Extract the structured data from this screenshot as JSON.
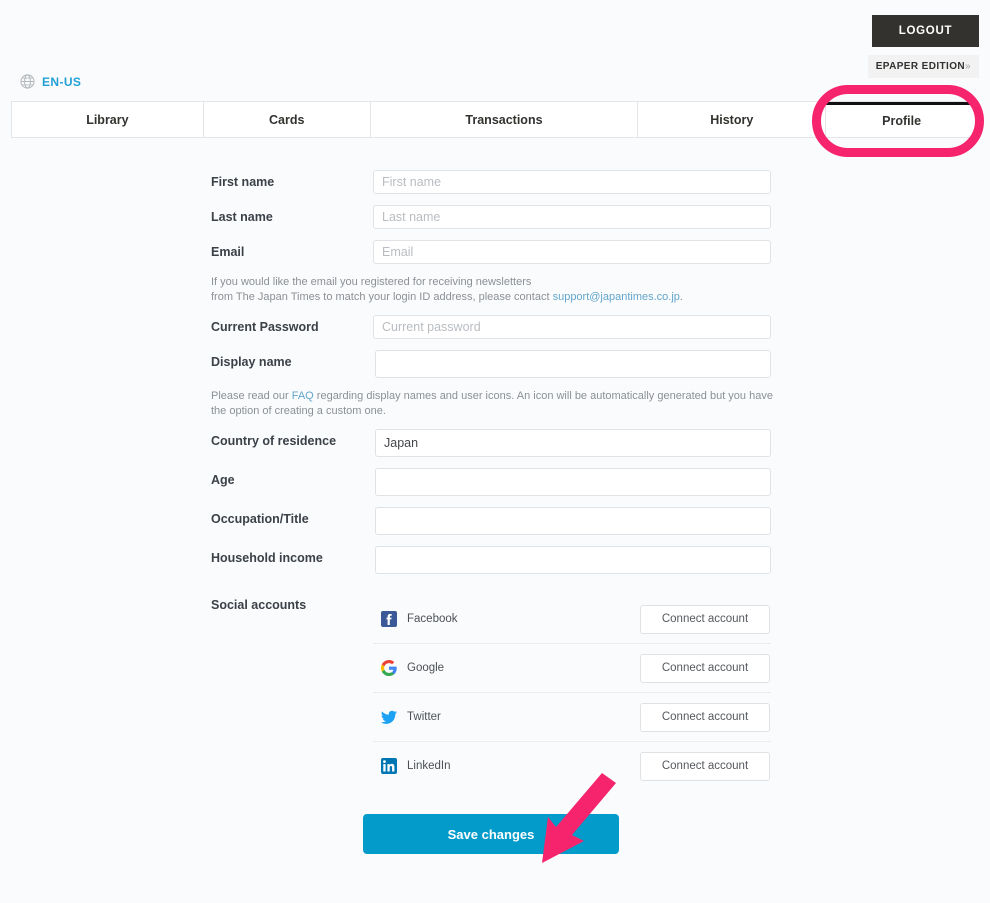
{
  "header": {
    "logout_label": "LOGOUT",
    "epaper_label": "EPAPER EDITION",
    "epaper_chevron": "»"
  },
  "locale": {
    "icon": "globe-icon",
    "label": "EN-US"
  },
  "tabs": [
    {
      "label": "Library",
      "active": false
    },
    {
      "label": "Cards",
      "active": false
    },
    {
      "label": "Transactions",
      "active": false
    },
    {
      "label": "History",
      "active": false
    },
    {
      "label": "Profile",
      "active": true
    }
  ],
  "form": {
    "fields": [
      {
        "label": "First name",
        "placeholder": "First name",
        "value": ""
      },
      {
        "label": "Last name",
        "placeholder": "Last name",
        "value": ""
      },
      {
        "label": "Email",
        "placeholder": "Email",
        "value": ""
      },
      {
        "label": "Current Password",
        "placeholder": "Current password",
        "value": ""
      },
      {
        "label": "Display name",
        "placeholder": "",
        "value": ""
      },
      {
        "label": "Country of residence",
        "placeholder": "",
        "value": "Japan"
      },
      {
        "label": "Age",
        "placeholder": "",
        "value": ""
      },
      {
        "label": "Occupation/Title",
        "placeholder": "",
        "value": ""
      },
      {
        "label": "Household income",
        "placeholder": "",
        "value": ""
      }
    ],
    "email_help": {
      "line1": "If you would like the email you registered for receiving newsletters",
      "line2_before": "from The Japan Times to match your login ID address, please contact ",
      "link": "support@japantimes.co.jp",
      "line2_after": "."
    },
    "display_name_help": {
      "before": "Please read our ",
      "link": "FAQ",
      "after": " regarding display names and user icons. An icon will be automatically generated but you have the option of creating a custom one."
    }
  },
  "social": {
    "title": "Social accounts",
    "accounts": [
      {
        "name": "Facebook",
        "icon": "facebook-icon",
        "button": "Connect account",
        "color": "#3b5998"
      },
      {
        "name": "Google",
        "icon": "google-icon",
        "button": "Connect account",
        "color": "#4285f4"
      },
      {
        "name": "Twitter",
        "icon": "twitter-icon",
        "button": "Connect account",
        "color": "#1da1f2"
      },
      {
        "name": "LinkedIn",
        "icon": "linkedin-icon",
        "button": "Connect account",
        "color": "#0077b5"
      }
    ]
  },
  "save": {
    "label": "Save changes",
    "color": "#039bca"
  },
  "annotations": {
    "highlight_color": "#f5246c",
    "ellipse_target": "Profile",
    "arrow_target": "Save changes"
  }
}
